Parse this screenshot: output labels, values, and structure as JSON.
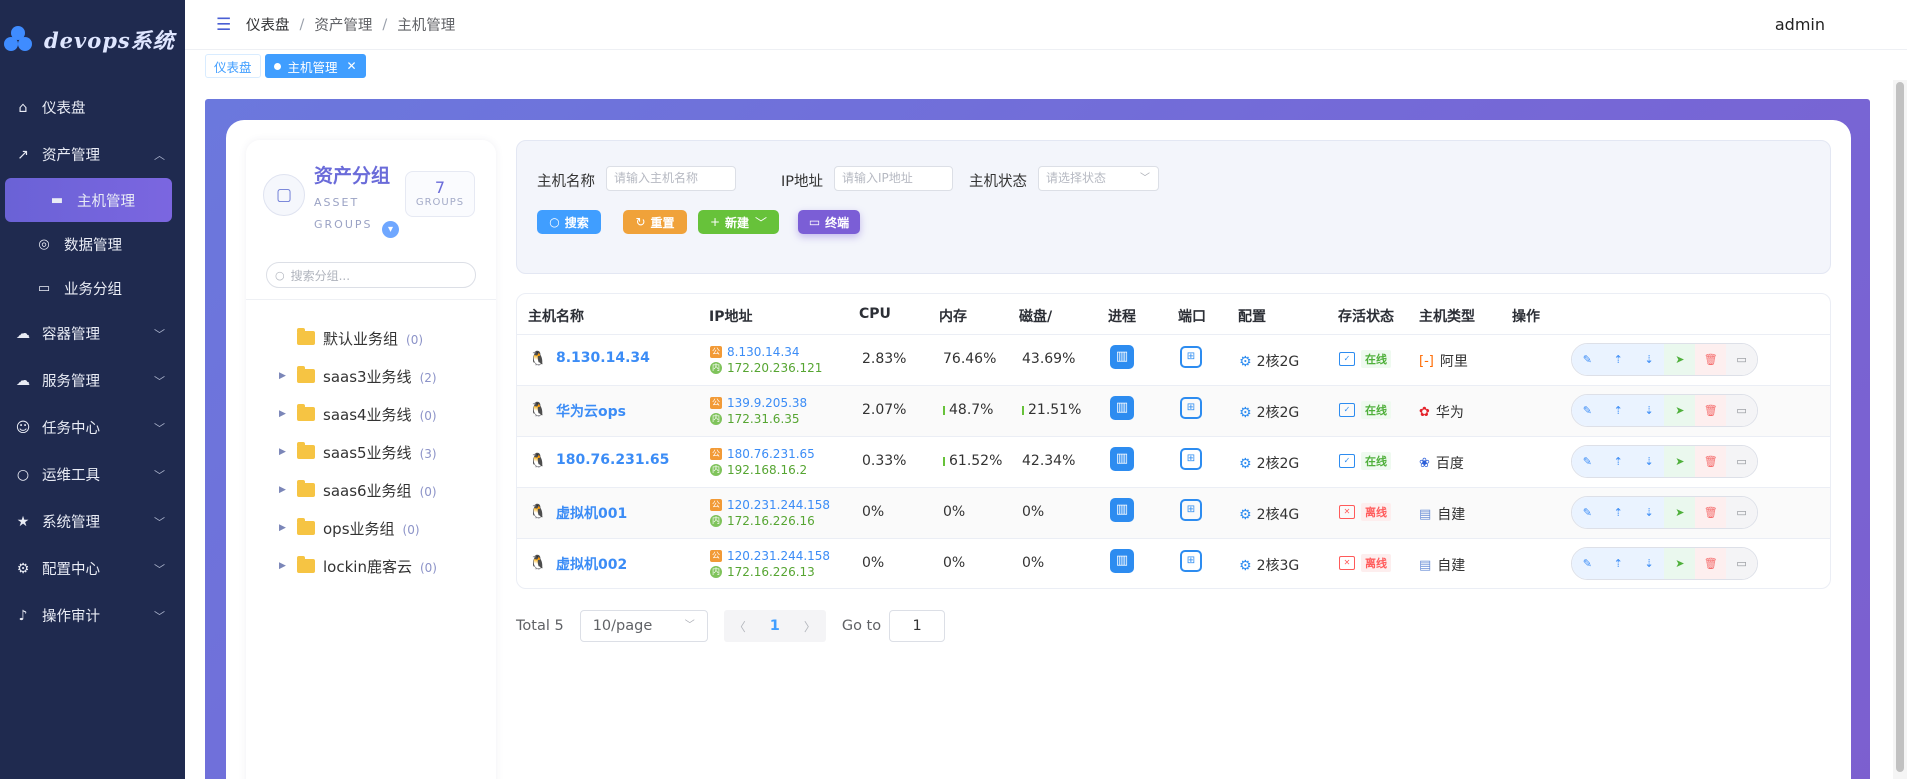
{
  "app": {
    "title": "devops系统"
  },
  "sidebar": {
    "items": [
      {
        "label": "仪表盘",
        "icon": "home-icon"
      },
      {
        "label": "资产管理",
        "icon": "chart-icon",
        "expanded": true,
        "children": [
          {
            "label": "主机管理",
            "icon": "monitor-icon",
            "active": true
          },
          {
            "label": "数据管理",
            "icon": "database-icon"
          },
          {
            "label": "业务分组",
            "icon": "tablet-icon"
          }
        ]
      },
      {
        "label": "容器管理",
        "icon": "cloud-upload-icon"
      },
      {
        "label": "服务管理",
        "icon": "cloud-upload-icon"
      },
      {
        "label": "任务中心",
        "icon": "user-icon"
      },
      {
        "label": "运维工具",
        "icon": "search-icon"
      },
      {
        "label": "系统管理",
        "icon": "star-icon"
      },
      {
        "label": "配置中心",
        "icon": "gear-icon"
      },
      {
        "label": "操作审计",
        "icon": "bell-icon"
      }
    ]
  },
  "header": {
    "breadcrumb": [
      "仪表盘",
      "资产管理",
      "主机管理"
    ],
    "user": "admin"
  },
  "tags": [
    {
      "label": "仪表盘",
      "active": false
    },
    {
      "label": "主机管理",
      "active": true
    }
  ],
  "groups": {
    "title": "资产分组",
    "subtitle": "ASSET GROUPS",
    "count": "7",
    "count_label": "GROUPS",
    "search_placeholder": "搜索分组...",
    "items": [
      {
        "name": "默认业务组",
        "count": "(0)",
        "has_children": false
      },
      {
        "name": "saas3业务线",
        "count": "(2)",
        "has_children": true
      },
      {
        "name": "saas4业务线",
        "count": "(0)",
        "has_children": true
      },
      {
        "name": "saas5业务线",
        "count": "(3)",
        "has_children": true
      },
      {
        "name": "saas6业务组",
        "count": "(0)",
        "has_children": true
      },
      {
        "name": "ops业务组",
        "count": "(0)",
        "has_children": true
      },
      {
        "name": "lockin鹿客云",
        "count": "(0)",
        "has_children": true
      }
    ]
  },
  "filter": {
    "host_label": "主机名称",
    "host_placeholder": "请输入主机名称",
    "ip_label": "IP地址",
    "ip_placeholder": "请输入IP地址",
    "status_label": "主机状态",
    "status_placeholder": "请选择状态",
    "search_btn": "搜索",
    "reset_btn": "重置",
    "new_btn": "新建",
    "terminal_btn": "终端",
    "colors": {
      "search": "#409eff",
      "reset": "#f0a23a",
      "new": "#67c23a",
      "terminal": "#7b5ed6"
    }
  },
  "table": {
    "columns": [
      "主机名称",
      "IP地址",
      "CPU",
      "内存",
      "磁盘/",
      "进程",
      "端口",
      "配置",
      "存活状态",
      "主机类型",
      "操作"
    ],
    "pub_badge": "公",
    "pri_badge": "内",
    "rows": [
      {
        "name": "8.130.14.34",
        "pub": "8.130.14.34",
        "pri": "172.20.236.121",
        "cpu": "2.83%",
        "mem": "76.46%",
        "disk": "43.69%",
        "conf": "2核2G",
        "status": "在线",
        "online": true,
        "type": "阿里",
        "type_icon": "aliyun-icon"
      },
      {
        "name": "华为云ops",
        "pub": "139.9.205.38",
        "pri": "172.31.6.35",
        "cpu": "2.07%",
        "mem": "48.7%",
        "disk": "21.51%",
        "conf": "2核2G",
        "status": "在线",
        "online": true,
        "type": "华为",
        "type_icon": "huawei-icon"
      },
      {
        "name": "180.76.231.65",
        "pub": "180.76.231.65",
        "pri": "192.168.16.2",
        "cpu": "0.33%",
        "mem": "61.52%",
        "disk": "42.34%",
        "conf": "2核2G",
        "status": "在线",
        "online": true,
        "type": "百度",
        "type_icon": "baidu-icon"
      },
      {
        "name": "虚拟机001",
        "pub": "120.231.244.158",
        "pri": "172.16.226.16",
        "cpu": "0%",
        "mem": "0%",
        "disk": "0%",
        "conf": "2核4G",
        "status": "离线",
        "online": false,
        "type": "自建",
        "type_icon": "building-icon"
      },
      {
        "name": "虚拟机002",
        "pub": "120.231.244.158",
        "pri": "172.16.226.13",
        "cpu": "0%",
        "mem": "0%",
        "disk": "0%",
        "conf": "2核3G",
        "status": "离线",
        "online": false,
        "type": "自建",
        "type_icon": "building-icon"
      }
    ]
  },
  "pagination": {
    "total_text": "Total 5",
    "page_size": "10/page",
    "current": "1",
    "goto_label": "Go to",
    "goto_value": "1"
  }
}
